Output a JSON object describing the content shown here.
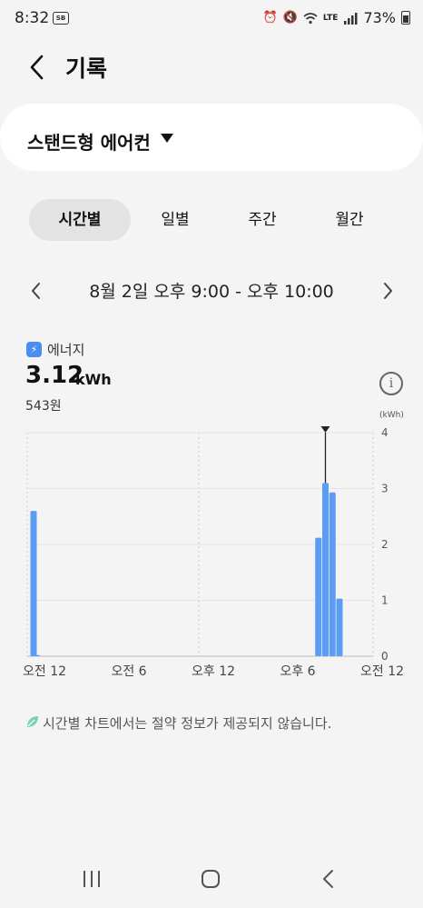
{
  "status_bar": {
    "time": "8:32",
    "notif_badge": "SB",
    "battery": "73%",
    "network": "LTE"
  },
  "header": {
    "title": "기록",
    "back_icon": "chevron-left-icon"
  },
  "device": {
    "name": "스탠드형 에어컨",
    "caret_icon": "caret-down-icon"
  },
  "tabs": [
    {
      "label": "시간별",
      "active": true
    },
    {
      "label": "일별",
      "active": false
    },
    {
      "label": "주간",
      "active": false
    },
    {
      "label": "월간",
      "active": false
    }
  ],
  "date_nav": {
    "range": "8월 2일 오후 9:00 - 오후 10:00"
  },
  "energy": {
    "label": "에너지",
    "value": "3.12",
    "unit": "kWh",
    "cost": "543원",
    "accent": "#4a8df0"
  },
  "chart_data": {
    "type": "bar",
    "unit_label": "(kWh)",
    "ylim": [
      0,
      4
    ],
    "y_ticks": [
      "0",
      "1",
      "2",
      "3",
      "4"
    ],
    "x_tick_labels": [
      "오전 12",
      "오전 6",
      "오후 12",
      "오후 6",
      "오전 12"
    ],
    "x_tick_hours": [
      0,
      6,
      12,
      18,
      24
    ],
    "bar_color": "#5b9cf5",
    "hours": [
      0,
      0.5,
      20.5,
      21,
      21.5,
      22
    ],
    "values": [
      2.6,
      0.02,
      2.12,
      3.1,
      2.93,
      1.03
    ],
    "selected_hour": 21
  },
  "note": {
    "text": "시간별 차트에서는 절약 정보가 제공되지 않습니다."
  }
}
